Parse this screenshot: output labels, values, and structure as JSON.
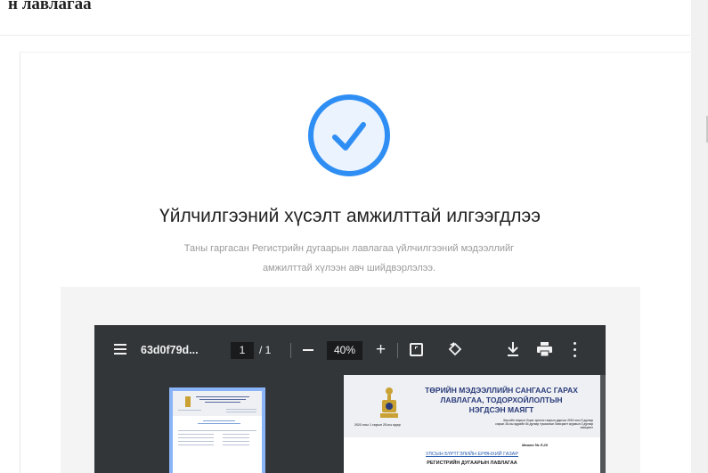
{
  "header": {
    "title_fragment": "н лавлагаа"
  },
  "success": {
    "icon": "check-circle-icon",
    "heading": "Үйлчилгээний хүсэлт амжилттай илгээгдлээ",
    "description": "Таны гаргасан Регистрийн дугаарын лавлагаа үйлчилгээний мэдээллийг амжилттай хүлээн авч шийдвэрлэлээ."
  },
  "pdf_viewer": {
    "file_name": "63d0f79d...",
    "current_page": "1",
    "total_pages": "/ 1",
    "zoom": "40%",
    "zoom_out_icon": "minus-icon",
    "zoom_in_label": "+",
    "icons": [
      "menu-icon",
      "fit-page-icon",
      "rotate-icon",
      "download-icon",
      "print-icon",
      "more-vert-icon"
    ]
  },
  "document": {
    "title_line1": "ТӨРИЙН МЭДЭЭЛЛИЙН САНГААС ГАРАХ",
    "title_line2": "ЛАВЛАГАА, ТОДОРХОЙЛОЛТЫН",
    "title_line3": "НЭГДСЭН МАЯГТ",
    "date_line": "2023 оны 1 сарын 25-ны өдөр",
    "note": "Засгийн газрын Хэрэг эрхлэх газрын даргын 2019 оны 5 дугаар сарын 28-ны өдрийн 84 дугаар тушаалын Хавсралт журмын 3 дугаар хавсралт",
    "form_no": "Маягт № Л-20",
    "org_name": "УЛСЫН БҮРТГЭЛИЙН ЕРӨНХИЙ ГАЗАР",
    "doc_name": "РЕГИСТРИЙН ДУГААРЫН ЛАВЛАГАА"
  },
  "colors": {
    "accent": "#2f8ef4",
    "toolbar": "#323639",
    "viewer_bg": "#525659",
    "doc_title": "#2b3c7a"
  }
}
